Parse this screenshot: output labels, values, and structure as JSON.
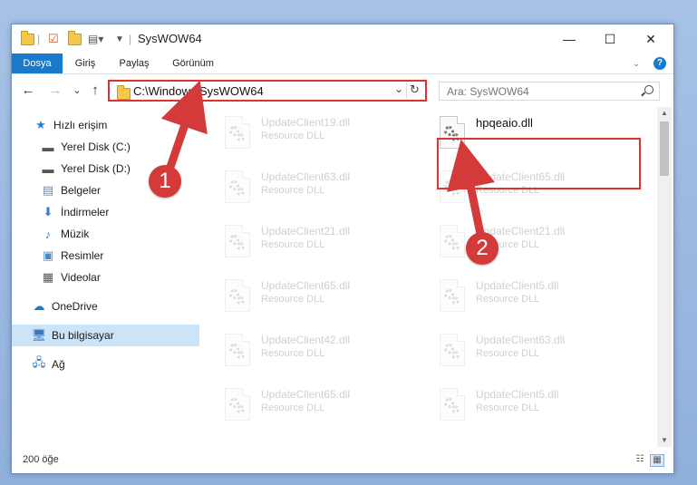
{
  "window": {
    "title": "SysWOW64",
    "controls": {
      "minimize": "—",
      "maximize": "☐",
      "close": "✕"
    }
  },
  "ribbon": {
    "tabs": [
      "Dosya",
      "Giriş",
      "Paylaş",
      "Görünüm"
    ],
    "help": "?"
  },
  "nav": {
    "back": "←",
    "forward": "→",
    "recent": "⌄",
    "up": "↑",
    "address": "C:\\Windows\\SysWOW64",
    "search_placeholder": "Ara: SysWOW64"
  },
  "sidebar": {
    "items": [
      {
        "label": "Hızlı erişim",
        "icon": "star-icon",
        "pinned": false
      },
      {
        "label": "Yerel Disk (C:)",
        "icon": "drive-icon",
        "pinned": false
      },
      {
        "label": "Yerel Disk (D:)",
        "icon": "drive-icon",
        "pinned": false
      },
      {
        "label": "Belgeler",
        "icon": "document-icon",
        "pinned": false
      },
      {
        "label": "İndirmeler",
        "icon": "download-icon",
        "pinned": true
      },
      {
        "label": "Müzik",
        "icon": "music-icon",
        "pinned": true
      },
      {
        "label": "Resimler",
        "icon": "picture-icon",
        "pinned": true
      },
      {
        "label": "Videolar",
        "icon": "video-icon",
        "pinned": true
      },
      {
        "label": "OneDrive",
        "icon": "cloud-icon",
        "pinned": false
      },
      {
        "label": "Bu bilgisayar",
        "icon": "computer-icon",
        "pinned": false,
        "selected": true
      },
      {
        "label": "Ağ",
        "icon": "network-icon",
        "pinned": false
      }
    ]
  },
  "files": {
    "left_column": [
      {
        "name": "UpdateClient19.dll",
        "type": "Resource DLL"
      },
      {
        "name": "UpdateClient63.dll",
        "type": "Resource DLL"
      },
      {
        "name": "UpdateClient21.dll",
        "type": "Resource DLL"
      },
      {
        "name": "UpdateClient65.dll",
        "type": "Resource DLL"
      },
      {
        "name": "UpdateClient42.dll",
        "type": "Resource DLL"
      },
      {
        "name": "UpdateClient65.dll",
        "type": "Resource DLL"
      }
    ],
    "right_column": [
      {
        "name": "hpqeaio.dll",
        "type": "",
        "highlighted": true
      },
      {
        "name": "UpdateClient65.dll",
        "type": "Resource DLL"
      },
      {
        "name": "UpdateClient21.dll",
        "type": "Resource DLL"
      },
      {
        "name": "UpdateClient5.dll",
        "type": "Resource DLL"
      },
      {
        "name": "UpdateClient63.dll",
        "type": "Resource DLL"
      },
      {
        "name": "UpdateClient5.dll",
        "type": "Resource DLL"
      }
    ]
  },
  "status": {
    "item_count": "200 öğe"
  },
  "annotations": {
    "step1": "1",
    "step2": "2",
    "color": "#d43a3a"
  }
}
